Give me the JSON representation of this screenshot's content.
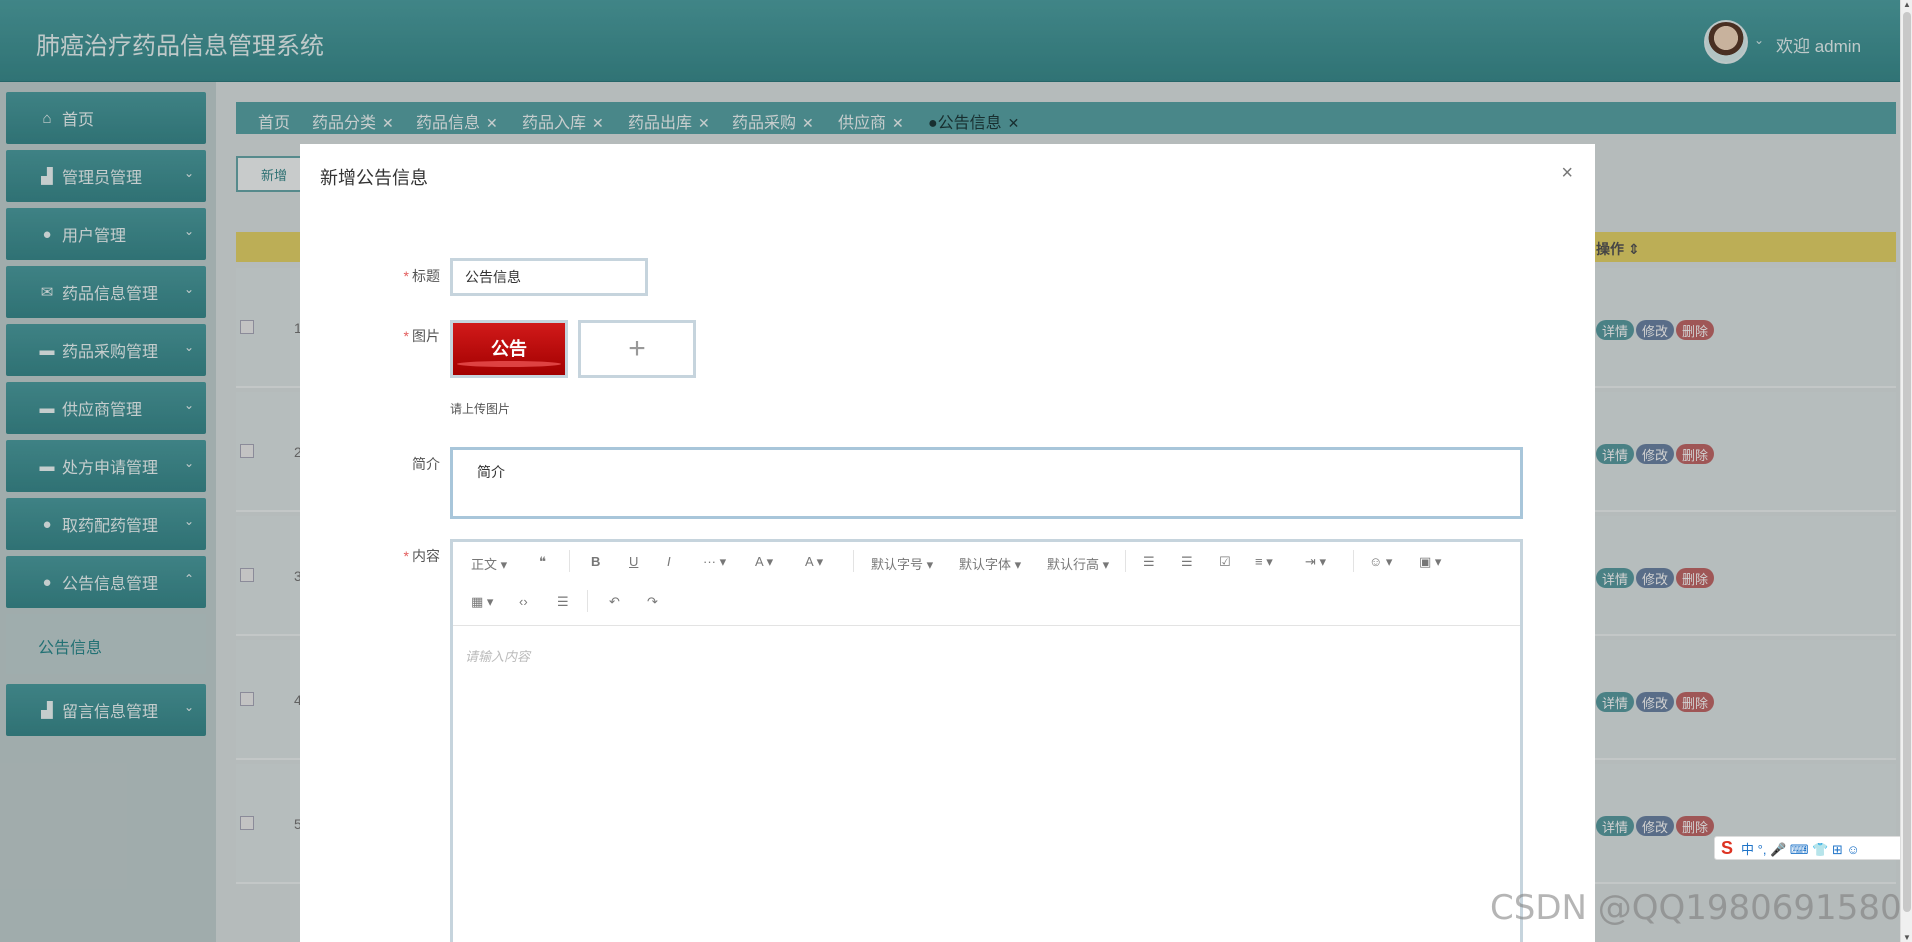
{
  "header": {
    "app_title": "肺癌治疗药品信息管理系统",
    "welcome": "欢迎 admin",
    "caret": "⌄"
  },
  "sidebar": {
    "items": [
      {
        "label": "首页",
        "icon": "⌂"
      },
      {
        "label": "管理员管理",
        "icon": "▟"
      },
      {
        "label": "用户管理",
        "icon": "●"
      },
      {
        "label": "药品信息管理",
        "icon": "✉"
      },
      {
        "label": "药品采购管理",
        "icon": "▬"
      },
      {
        "label": "供应商管理",
        "icon": "▬"
      },
      {
        "label": "处方申请管理",
        "icon": "▬"
      },
      {
        "label": "取药配药管理",
        "icon": "●"
      },
      {
        "label": "公告信息管理",
        "icon": "●"
      },
      {
        "label": "留言信息管理",
        "icon": "▟"
      }
    ],
    "submenu_item": "公告信息",
    "arrow_down": "⌄",
    "arrow_up": "⌃"
  },
  "tabs": [
    {
      "label": "首页",
      "closable": false
    },
    {
      "label": "药品分类",
      "closable": true
    },
    {
      "label": "药品信息",
      "closable": true
    },
    {
      "label": "药品入库",
      "closable": true
    },
    {
      "label": "药品出库",
      "closable": true
    },
    {
      "label": "药品采购",
      "closable": true
    },
    {
      "label": "供应商",
      "closable": true
    },
    {
      "label": "●公告信息",
      "closable": true,
      "active": true
    }
  ],
  "toolbar": {
    "add_label": "新增"
  },
  "table": {
    "op_header": "操作 ⇕",
    "rows": [
      "1",
      "2",
      "3",
      "4",
      "5"
    ],
    "detail": "详情",
    "edit": "修改",
    "delete": "删除"
  },
  "dialog": {
    "title": "新增公告信息",
    "close": "×",
    "title_label": "标题",
    "title_value": "公告信息",
    "image_label": "图片",
    "image_text": "公告",
    "add_icon": "+",
    "upload_tip": "请上传图片",
    "intro_label": "简介",
    "intro_value": "简介",
    "content_label": "内容",
    "required_mark": "*",
    "content_placeholder": "请输入内容",
    "editor_toolbar": {
      "paragraph": "正文 ▾",
      "quote": "❝",
      "bold": "B",
      "underline": "U",
      "italic": "I",
      "more": "··· ▾",
      "font_color": "A ▾",
      "bg_color": "A ▾",
      "font_size": "默认字号 ▾",
      "font_family": "默认字体 ▾",
      "line_height": "默认行高 ▾",
      "bullet_list": "☰",
      "numbered_list": "☰",
      "todo": "☑",
      "align": "≡ ▾",
      "indent": "⇥ ▾",
      "emoji": "☺ ▾",
      "image": "▣ ▾",
      "table": "▦ ▾",
      "code": "‹›",
      "divider": "☰",
      "undo": "↶",
      "redo": "↷"
    }
  },
  "ime": {
    "logo": "S",
    "label": "中 °, 🎤 ⌨ 👕 ⊞ ☺"
  },
  "watermark": "CSDN @QQ1980691580"
}
